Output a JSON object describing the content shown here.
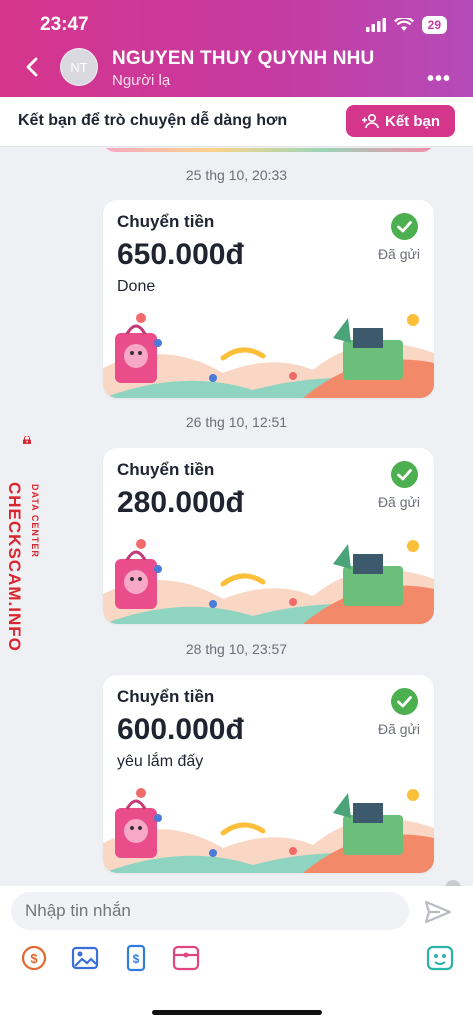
{
  "status": {
    "time": "23:47",
    "battery": "29"
  },
  "header": {
    "avatar_initials": "NT",
    "name": "NGUYEN THUY QUYNH NHU",
    "subtitle": "Người lạ"
  },
  "friend_bar": {
    "text": "Kết bạn để trò chuyện dễ dàng hơn",
    "button": "Kết bạn"
  },
  "messages": [
    {
      "timestamp": "25 thg 10, 20:33",
      "title": "Chuyển tiền",
      "amount": "650.000đ",
      "note": "Done",
      "status": "Đã gửi"
    },
    {
      "timestamp": "26 thg 10, 12:51",
      "title": "Chuyển tiền",
      "amount": "280.000đ",
      "note": "",
      "status": "Đã gửi"
    },
    {
      "timestamp": "28 thg 10, 23:57",
      "title": "Chuyển tiền",
      "amount": "600.000đ",
      "note": "yêu lắm đấy",
      "status": "Đã gửi"
    }
  ],
  "watermark": {
    "text": "CHECKSCAM.INFO",
    "sub": "DATA CENTER"
  },
  "composer": {
    "placeholder": "Nhập tin nhắn"
  },
  "colors": {
    "brand": "#d6358c",
    "check": "#4caf50",
    "watermark": "#d8262e"
  }
}
